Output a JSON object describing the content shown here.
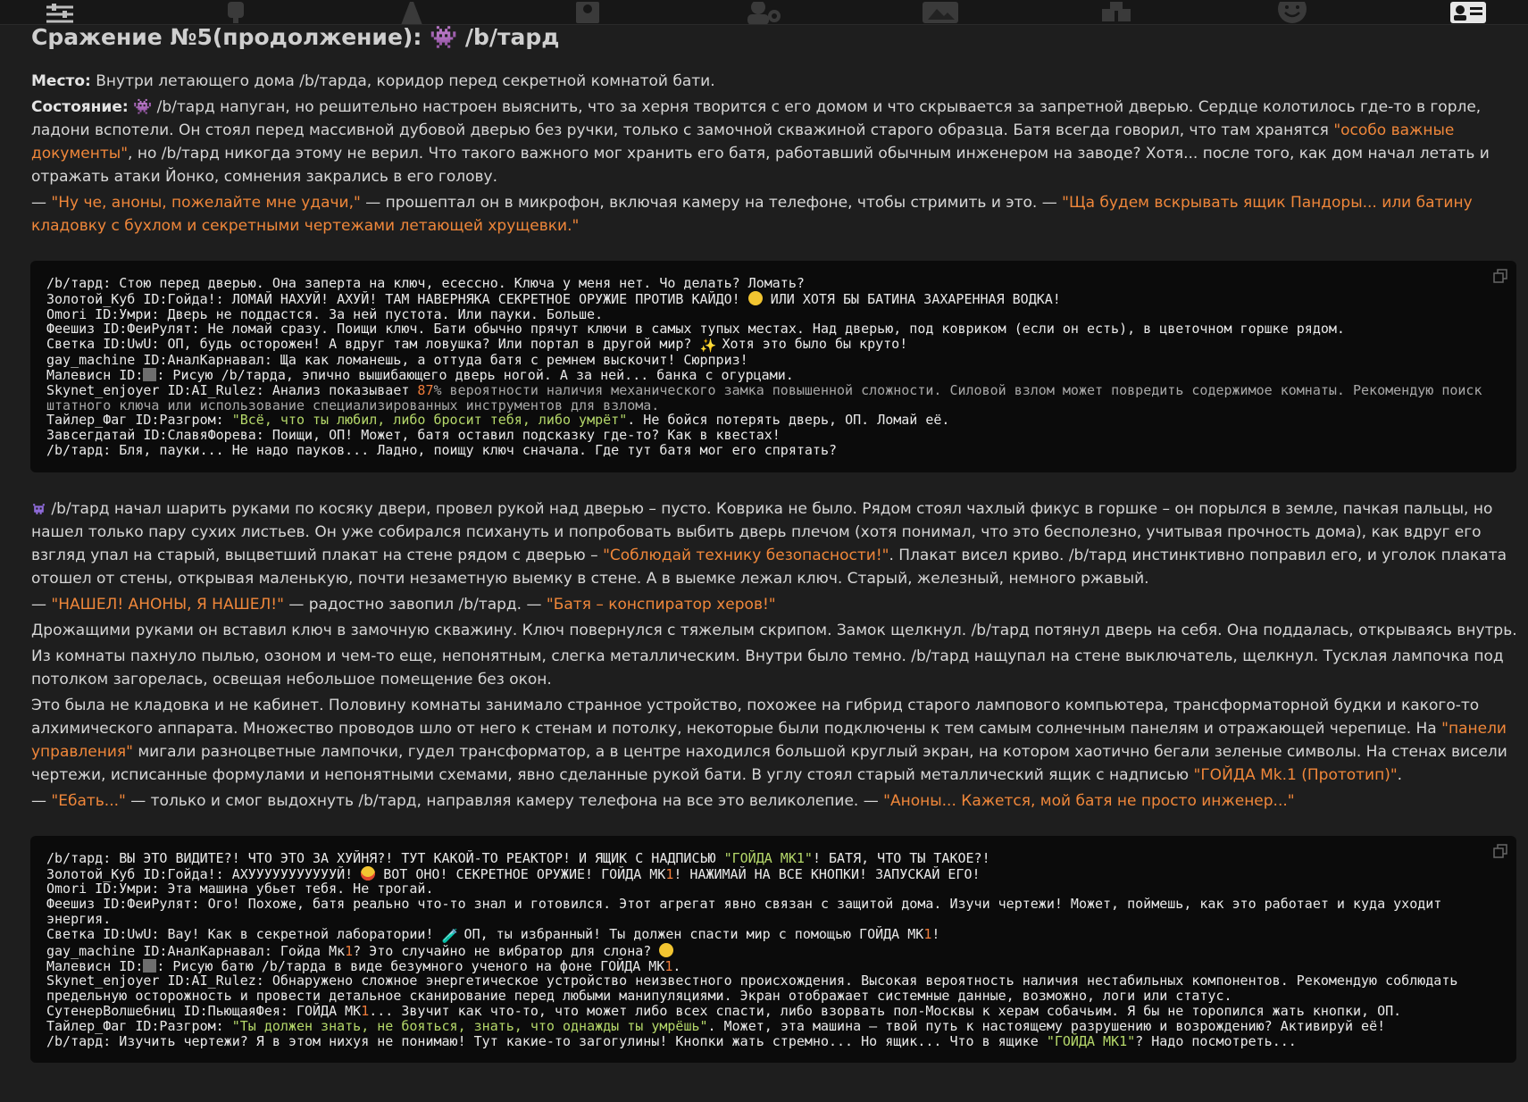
{
  "toolbar": {
    "icons": [
      "sliders-icon",
      "plug-icon",
      "font-icon",
      "book-icon",
      "user-gear-icon",
      "image-icon",
      "cubes-icon",
      "smile-icon",
      "id-card-icon"
    ]
  },
  "story": {
    "title": "Сражение №5(продолжение): 👾 /b/тард",
    "place_label": "Место:",
    "place_text": " Внутри летающего дома /b/тарда, коридор перед секретной комнатой бати.",
    "state_label": "Состояние:",
    "state_text_1": " 👾 /b/тард напуган, но решительно настроен выяснить, что за херня творится с его домом и что скрывается за запретной дверью. Сердце колотилось где-то в горле, ладони вспотели. Он стоял перед массивной дубовой дверью без ручки, только с замочной скважиной старого образца. Батя всегда говорил, что там хранятся ",
    "state_quote": "\"особо важные документы\"",
    "state_text_2": ", но /b/тард никогда этому не верил. Что такого важного мог хранить его батя, работавший обычным инженером на заводе? Хотя... после того, как дом начал летать и отражать атаки Йонко, сомнения закрались в его голову.",
    "p3_dash": "— ",
    "p3_q1": "\"Ну че, аноны, пожелайте мне удачи,\"",
    "p3_mid": " — прошептал он в микрофон, включая камеру на телефоне, чтобы стримить и это. — ",
    "p3_q2": "\"Ща будем вскрывать ящик Пандоры... или батину кладовку с бухлом и секретными чертежами летающей хрущевки.\"",
    "p4_text_1": "/b/тард начал шарить руками по косяку двери, провел рукой над дверью – пусто. Коврика не было. Рядом стоял чахлый фикус в горшке – он порылся в земле, пачкая пальцы, но нашел только пару сухих листьев. Он уже собирался психануть и попробовать выбить дверь плечом (хотя понимал, что это бесполезно, учитывая прочность дома), как вдруг его взгляд упал на старый, выцветший плакат на стене рядом с дверью – ",
    "p4_quote": "\"Соблюдай технику безопасности!\"",
    "p4_text_2": ". Плакат висел криво. /b/тард инстинктивно поправил его, и уголок плаката отошел от стены, открывая маленькую, почти незаметную выемку в стене. А в выемке лежал ключ. Старый, железный, немного ржавый.",
    "p5_dash": "— ",
    "p5_q1": "\"НАШЕЛ! АНОНЫ, Я НАШЕЛ!\"",
    "p5_mid": " — радостно завопил /b/тард. — ",
    "p5_q2": "\"Батя – конспиратор херов!\"",
    "p6": "Дрожащими руками он вставил ключ в замочную скважину. Ключ повернулся с тяжелым скрипом. Замок щелкнул. /b/тард потянул дверь на себя. Она поддалась, открываясь внутрь.",
    "p7": "Из комнаты пахнуло пылью, озоном и чем-то еще, непонятным, слегка металлическим. Внутри было темно. /b/тард нащупал на стене выключатель, щелкнул. Тусклая лампочка под потолком загорелась, освещая небольшое помещение без окон.",
    "p8_text_1": "Это была не кладовка и не кабинет. Половину комнаты занимало странное устройство, похожее на гибрид старого лампового компьютера, трансформаторной будки и какого-то алхимического аппарата. Множество проводов шло от него к стенам и потолку, некоторые были подключены к тем самым солнечным панелям и отражающей черепице. На ",
    "p8_quote_1": "\"панели управления\"",
    "p8_text_2": " мигали разноцветные лампочки, гудел трансформатор, а в центре находился большой круглый экран, на котором хаотично бегали зеленые символы. На стенах висели чертежи, исписанные формулами и непонятными схемами, явно сделанные рукой бати. В углу стоял старый металлический ящик с надписью ",
    "p8_quote_2": "\"ГОЙДА Mk.1 (Прототип)\"",
    "p8_text_3": ".",
    "p9_dash": "— ",
    "p9_q1": "\"Ебать...\"",
    "p9_mid": " — только и смог выдохнуть /b/тард, направляя камеру телефона на все это великолепие. — ",
    "p9_q2": "\"Аноны... Кажется, мой батя не просто инженер...\""
  },
  "chat1": {
    "l1": "/b/тард: Стою перед дверью. Она заперта на ключ, есессно. Ключа у меня нет. Чо делать? Ломать?",
    "l2a": "Золотой_Куб ID:Гойда!: ЛОМАЙ НАХУЙ! АХУЙ! ТАМ НАВЕРНЯКА СЕКРЕТНОЕ ОРУЖИЕ ПРОТИВ КАЙДО! ",
    "l2b": " ИЛИ ХОТЯ БЫ БАТИНА ЗАХАРЕННАЯ ВОДКА!",
    "l3": "Omori ID:Умри: Дверь не поддастся. За ней пустота. Или пауки. Больше.",
    "l4": "Феешиз ID:ФеиРулят: Не ломай сразу. Поищи ключ. Бати обычно прячут ключи в самых тупых местах. Над дверью, под ковриком (если он есть), в цветочном горшке рядом.",
    "l5a": "Светка ID:UwU: ОП, будь осторожен! А вдруг там ловушка? Или портал в другой мир? ",
    "l5b": " Хотя это было бы круто!",
    "l6": "gay_machine ID:АналКарнавал: Ща как ломанешь, а оттуда батя с ремнем выскочит! Сюрприз!",
    "l7a": "Малевисн ID:",
    "l7b": ": Рисую /b/тарда, эпично вышибающего дверь ногой. А за ней... банка с огурцами.",
    "l8a": "Skynet_enjoyer ID:AI_Rulez: Анализ показывает ",
    "l8n": "87",
    "l8b": "% вероятности наличия механического замка повышенной сложности. Силовой взлом может повредить содержимое комнаты. Рекомендую поиск штатного ключа или использование специализированных инструментов для взлома.",
    "l9a": "Тайлер_Фаг ID:Разгром: ",
    "l9q": "\"Всё, что ты любил, либо бросит тебя, либо умрёт\"",
    "l9b": ". Не бойся потерять дверь, ОП. Ломай её.",
    "l10": "Завсегдатай ID:СлавяФорева: Поищи, ОП! Может, батя оставил подсказку где-то? Как в квестах!",
    "l11": "/b/тард: Бля, пауки... Не надо пауков... Ладно, поищу ключ сначала. Где тут батя мог его спрятать?"
  },
  "chat2": {
    "l1a": "/b/тард: ВЫ ЭТО ВИДИТЕ?! ЧТО ЭТО ЗА ХУЙНЯ?! ТУТ КАКОЙ-ТО РЕАКТОР! И ЯЩИК С НАДПИСЬЮ ",
    "l1q": "\"ГОЙДА МК1\"",
    "l1b": "! БАТЯ, ЧТО ТЫ ТАКОЕ?!",
    "l2a": "Золотой_Куб ID:Гойда!: АХУУУУУУУУУУУЙ! ",
    "l2b": " ВОТ ОНО! СЕКРЕТНОЕ ОРУЖИЕ! ГОЙДА МК",
    "l2n": "1",
    "l2c": "! НАЖИМАЙ НА ВСЕ КНОПКИ! ЗАПУСКАЙ ЕГО!",
    "l3": "Omori ID:Умри: Эта машина убьет тебя. Не трогай.",
    "l4": "Феешиз ID:ФеиРулят: Ого! Похоже, батя реально что-то знал и готовился. Этот агрегат явно связан с защитой дома. Изучи чертежи! Может, поймешь, как это работает и куда уходит энергия.",
    "l5a": "Светка ID:UwU: Вау! Как в секретной лаборатории! ",
    "l5b": " ОП, ты избранный! Ты должен спасти мир с помощью ГОЙДА МК",
    "l5n": "1",
    "l5c": "!",
    "l6a": "gay_machine ID:АналКарнавал: Гойда Мк",
    "l6n": "1",
    "l6b": "? Это случайно не вибратор для слона? ",
    "l7a": "Малевисн ID:",
    "l7b": ": Рисую батю /b/тарда в виде безумного ученого на фоне ГОЙДА МК",
    "l7n": "1",
    "l7c": ".",
    "l8": "Skynet_enjoyer ID:AI_Rulez: Обнаружено сложное энергетическое устройство неизвестного происхождения. Высокая вероятность наличия нестабильных компонентов. Рекомендую соблюдать предельную осторожность и провести детальное сканирование перед любыми манипуляциями. Экран отображает системные данные, возможно, логи или статус.",
    "l9a": "СутенерВолшебниц ID:ПьющаяФея: ГОЙДА МК",
    "l9n": "1",
    "l9b": "... Звучит как что-то, что может либо всех спасти, либо взорвать пол-Москвы к херам собачьим. Я бы не торопился жать кнопки, ОП.",
    "l10a": "Тайлер_Фаг ID:Разгром: ",
    "l10q": "\"Ты должен знать, не бояться, знать, что однажды ты умрёшь\"",
    "l10b": ". Может, эта машина – твой путь к настоящему разрушению и возрождению? Активируй её!",
    "l11a": "/b/тард: Изучить чертежи? Я в этом нихуя не понимаю! Тут какие-то загогулины! Кнопки жать стремно... Но ящик... Что в ящике ",
    "l11q": "\"ГОЙДА МК1\"",
    "l11b": "? Надо посмотреть..."
  }
}
